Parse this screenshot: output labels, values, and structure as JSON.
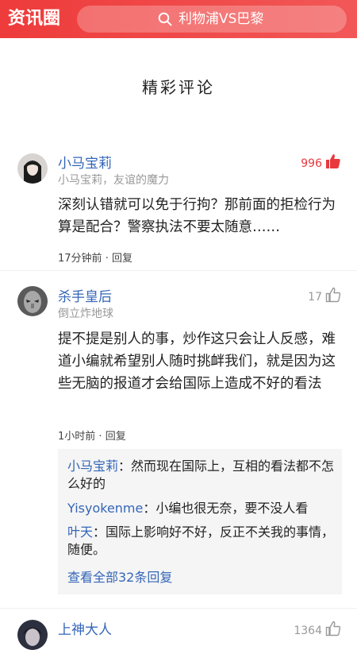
{
  "header": {
    "logo_text": "资讯圈",
    "search_query": "利物浦VS巴黎",
    "search_icon": "search-icon",
    "brand_color": "#ee3b3b"
  },
  "section": {
    "title": "精彩评论"
  },
  "comments": [
    {
      "name": "小马宝莉",
      "subtitle": "小马宝莉，友谊的魔力",
      "likes": "996",
      "liked": true,
      "text": "深刻认错就可以免于行拘？那前面的拒检行为算是配合？警察执法不要太随意……",
      "time": "17分钟前",
      "reply_label": "回复"
    },
    {
      "name": "杀手皇后",
      "subtitle": "倒立炸地球",
      "likes": "17",
      "liked": false,
      "text": "提不提是别人的事，炒作这只会让人反感，难道小编就希望别人随时挑衅我们，就是因为这些无脑的报道才会给国际上造成不好的看法",
      "time": "1小时前",
      "reply_label": "回复",
      "replies": [
        {
          "who": "小马宝莉",
          "text": "然而现在国际上，互相的看法都不怎么好的"
        },
        {
          "who": "Yisyokenme",
          "text": "小编也很无奈，要不没人看"
        },
        {
          "who": "叶天",
          "text": "国际上影响好不好，反正不关我的事情，随便。"
        }
      ],
      "more_label": "查看全部32条回复"
    },
    {
      "name": "上神大人",
      "likes": "1364",
      "liked": false
    }
  ],
  "colors": {
    "name": "#3466b8",
    "liked": "#e8383d",
    "muted": "#999999"
  }
}
